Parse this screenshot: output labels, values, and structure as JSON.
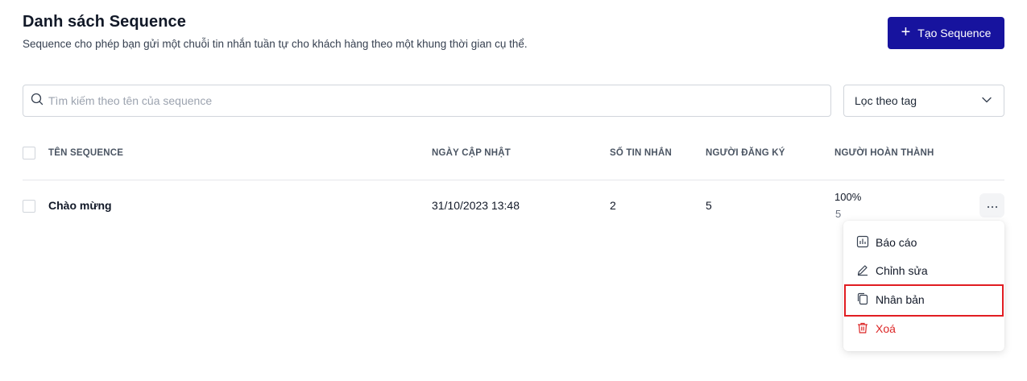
{
  "header": {
    "title": "Danh sách Sequence",
    "subtitle": "Sequence cho phép bạn gửi một chuỗi tin nhắn tuần tự cho khách hàng theo một khung thời gian cụ thể.",
    "create_button": "Tạo Sequence",
    "create_icon": "plus-icon"
  },
  "search": {
    "placeholder": "Tìm kiếm theo tên của sequence",
    "value": "",
    "icon": "search-icon"
  },
  "tag_filter": {
    "label": "Lọc theo tag",
    "icon": "chevron-down-icon"
  },
  "table": {
    "columns": [
      "TÊN SEQUENCE",
      "NGÀY CẬP NHẬT",
      "SỐ TIN NHẮN",
      "NGƯỜI ĐĂNG KÝ",
      "NGƯỜI HOÀN THÀNH"
    ],
    "rows": [
      {
        "name": "Chào mừng",
        "updated": "31/10/2023 13:48",
        "messages": "2",
        "subscribers": "5",
        "completed_percent": "100%",
        "completed_count": "5"
      }
    ]
  },
  "row_menu": {
    "items": [
      {
        "label": "Báo cáo",
        "icon": "bar-chart-icon"
      },
      {
        "label": "Chỉnh sửa",
        "icon": "pencil-icon"
      },
      {
        "label": "Nhân bản",
        "icon": "copy-icon"
      },
      {
        "label": "Xoá",
        "icon": "trash-icon"
      }
    ]
  },
  "colors": {
    "primary": "#17139e",
    "danger": "#dc2626",
    "highlight": "#e11d22"
  }
}
